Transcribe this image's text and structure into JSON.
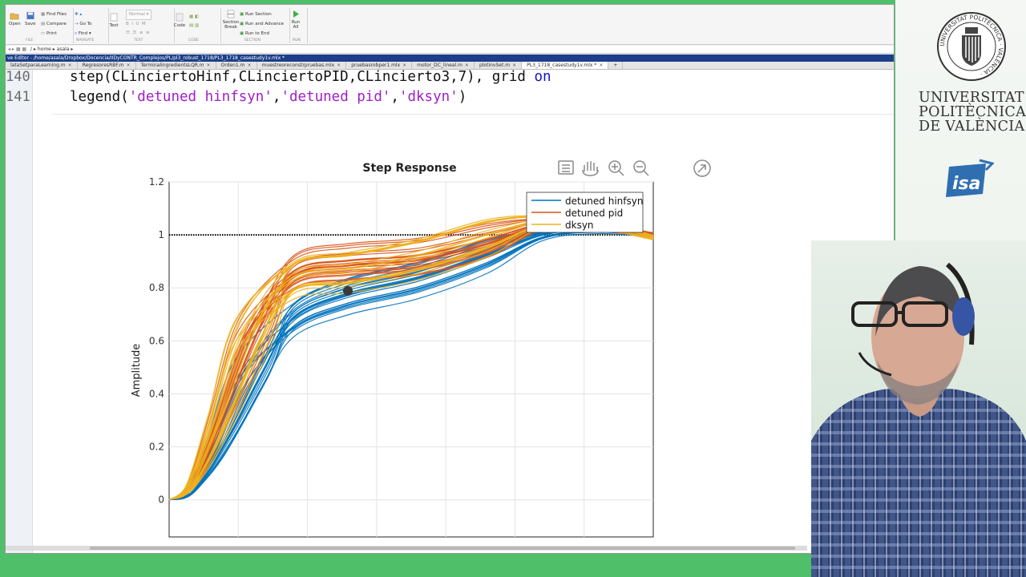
{
  "ribbon": {
    "file": {
      "open": "Open",
      "save": "Save",
      "find_files": "Find Files",
      "compare": "Compare",
      "print": "Print",
      "section": "FILE"
    },
    "navigate": {
      "go_to": "Go To",
      "find": "Find",
      "section": "NAVIGATE"
    },
    "text": {
      "text": "Text",
      "normal": "Normal",
      "section": "TEXT"
    },
    "code": {
      "code": "Code",
      "section": "CODE"
    },
    "section": {
      "section_break": "Section Break",
      "run_section": "Run Section",
      "run_and_advance": "Run and Advance",
      "run_to_end": "Run to End",
      "section": "SECTION"
    },
    "run": {
      "run_all": "Run All",
      "section": "RUN"
    }
  },
  "address": {
    "path": "/ ▸ home ▸ asala ▸"
  },
  "window": {
    "title": "ve Editor - /home/asala/Dropbox/Docencia/IIDyCONTR_Complejos/PL/pl3_robust_1718/PL3_1718_casestudy1v.mlx *"
  },
  "tabs": [
    {
      "label": "lataSetparaLearning.m",
      "active": false
    },
    {
      "label": "RegresoresRBF.m",
      "active": false
    },
    {
      "label": "TerminalingredientsLQR.m",
      "active": false
    },
    {
      "label": "Orden1.m",
      "active": false
    },
    {
      "label": "muestreoreconstrpruebas.mlx",
      "active": false
    },
    {
      "label": "pruebasrobper1.mlx",
      "active": false
    },
    {
      "label": "motor_DC_lineal.m",
      "active": false
    },
    {
      "label": "plotinvSet.m",
      "active": false
    },
    {
      "label": "PL3_1718_casestudy1v.mlx *",
      "active": true
    }
  ],
  "editor": {
    "lines": [
      {
        "number": "140",
        "text_a": "step(CLinciertoHinf,CLinciertoPID,CLincierto3,7), grid ",
        "kw": "on"
      },
      {
        "number": "141",
        "text_a": "legend(",
        "s1": "'detuned hinfsyn'",
        "c1": ",",
        "s2": "'detuned pid'",
        "c2": ",",
        "s3": "'dksyn'",
        "text_b": ")"
      }
    ]
  },
  "chart_data": {
    "type": "line",
    "title": "Step Response",
    "ylabel": "Amplitude",
    "xlabel": "",
    "ylim": [
      -0.14,
      1.2
    ],
    "yticks": [
      0,
      0.2,
      0.4,
      0.6,
      0.8,
      1,
      1.2
    ],
    "ytick_labels": [
      "0",
      "0.2",
      "0.4",
      "0.6",
      "0.8",
      "1",
      "1.2"
    ],
    "grid": true,
    "legend_position": "top-right",
    "reference_level": 1,
    "series": [
      {
        "name": "detuned hinfsyn",
        "color": "#0072bd",
        "x": [
          0,
          0.3,
          0.7,
          1.2,
          1.8,
          2.6,
          3.6,
          4.6,
          5.4,
          6.2,
          7
        ],
        "y": [
          0,
          0.03,
          0.2,
          0.48,
          0.68,
          0.77,
          0.83,
          0.92,
          1.0,
          1.02,
          1.0
        ]
      },
      {
        "name": "detuned pid",
        "color": "#d95319",
        "x": [
          0,
          0.3,
          0.7,
          1.2,
          1.8,
          2.6,
          3.6,
          4.6,
          5.4,
          6.2,
          7
        ],
        "y": [
          0,
          0.05,
          0.3,
          0.65,
          0.86,
          0.9,
          0.92,
          0.98,
          1.04,
          1.03,
          1.0
        ]
      },
      {
        "name": "dksyn",
        "color": "#edb120",
        "x": [
          0,
          0.3,
          0.7,
          1.2,
          1.8,
          2.6,
          3.6,
          4.6,
          5.4,
          6.2,
          7
        ],
        "y": [
          0,
          0.05,
          0.28,
          0.63,
          0.83,
          0.86,
          0.91,
          0.99,
          1.05,
          1.04,
          0.99
        ]
      }
    ]
  },
  "plot_toolbar": {
    "icons": [
      "export-icon",
      "pan-icon",
      "zoom-in-icon",
      "zoom-out-icon",
      "restore-view-icon"
    ]
  },
  "branding": {
    "line1": "UNIVERSITAT",
    "line2": "POLITÈCNICA",
    "line3": "DE VALÈNCIA",
    "seal_text": "UNIVERSITAT POLITÈCNICA · VALÈNCIA ·",
    "isa": "isa"
  }
}
